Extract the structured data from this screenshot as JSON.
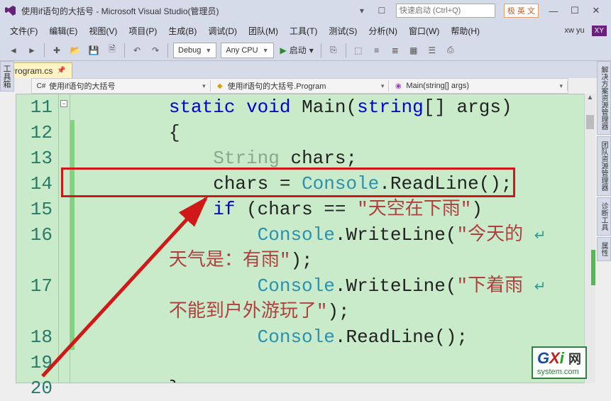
{
  "titlebar": {
    "title": "使用if语句的大括号 - Microsoft Visual Studio(管理员)",
    "quicklaunch_placeholder": "快速启动 (Ctrl+Q)",
    "ime_badge": "极 英 文"
  },
  "menubar": {
    "items": [
      {
        "label": "文件(F)"
      },
      {
        "label": "编辑(E)"
      },
      {
        "label": "视图(V)"
      },
      {
        "label": "项目(P)"
      },
      {
        "label": "生成(B)"
      },
      {
        "label": "调试(D)"
      },
      {
        "label": "团队(M)"
      },
      {
        "label": "工具(T)"
      },
      {
        "label": "测试(S)"
      },
      {
        "label": "分析(N)"
      },
      {
        "label": "窗口(W)"
      },
      {
        "label": "帮助(H)"
      }
    ],
    "user": "xw yu",
    "user_initials": "XY"
  },
  "toolbar": {
    "config_dropdown": "Debug",
    "platform_dropdown": "Any CPU",
    "start_label": "启动"
  },
  "tabs": {
    "active": "Program.cs"
  },
  "contextbar": {
    "seg1": "使用if语句的大括号",
    "seg2": "使用if语句的大括号.Program",
    "seg3": "Main(string[] args)"
  },
  "left_tool": "工具箱",
  "right_tools": [
    "解决方案资源管理器",
    "团队资源管理器",
    "诊断工具",
    "属性"
  ],
  "code": {
    "lines": [
      {
        "num": "11",
        "html": "        <span class=\"kw\">static</span> <span class=\"kw\">void</span> Main(<span class=\"kw\">string</span>[] args)"
      },
      {
        "num": "12",
        "html": "        {"
      },
      {
        "num": "13",
        "html": "            <span class=\"cls faded\">String</span> chars;"
      },
      {
        "num": "14",
        "html": "            chars = <span class=\"cls\">Console</span>.ReadLine();"
      },
      {
        "num": "15",
        "html": "            <span class=\"kw\">if</span> (chars == <span class=\"str\">\"天空在下雨\"</span>)"
      },
      {
        "num": "16",
        "html": "                <span class=\"cls\">Console</span>.WriteLine(<span class=\"str\">\"今天的</span> <span class=\"wrap-glyph\">↵</span>"
      },
      {
        "num": "",
        "html": "        <span class=\"str\">天气是：有雨\"</span>);"
      },
      {
        "num": "17",
        "html": "                <span class=\"cls\">Console</span>.WriteLine(<span class=\"str\">\"下着雨</span> <span class=\"wrap-glyph\">↵</span>"
      },
      {
        "num": "",
        "html": "        <span class=\"str\">不能到户外游玩了\"</span>);"
      },
      {
        "num": "18",
        "html": "                <span class=\"cls\">Console</span>.ReadLine();"
      },
      {
        "num": "19",
        "html": ""
      },
      {
        "num": "20",
        "html": "        }"
      }
    ]
  },
  "watermark": {
    "big_g": "G",
    "big_x": "X",
    "big_i": "i",
    "suffix": "网",
    "small": "system.com"
  }
}
